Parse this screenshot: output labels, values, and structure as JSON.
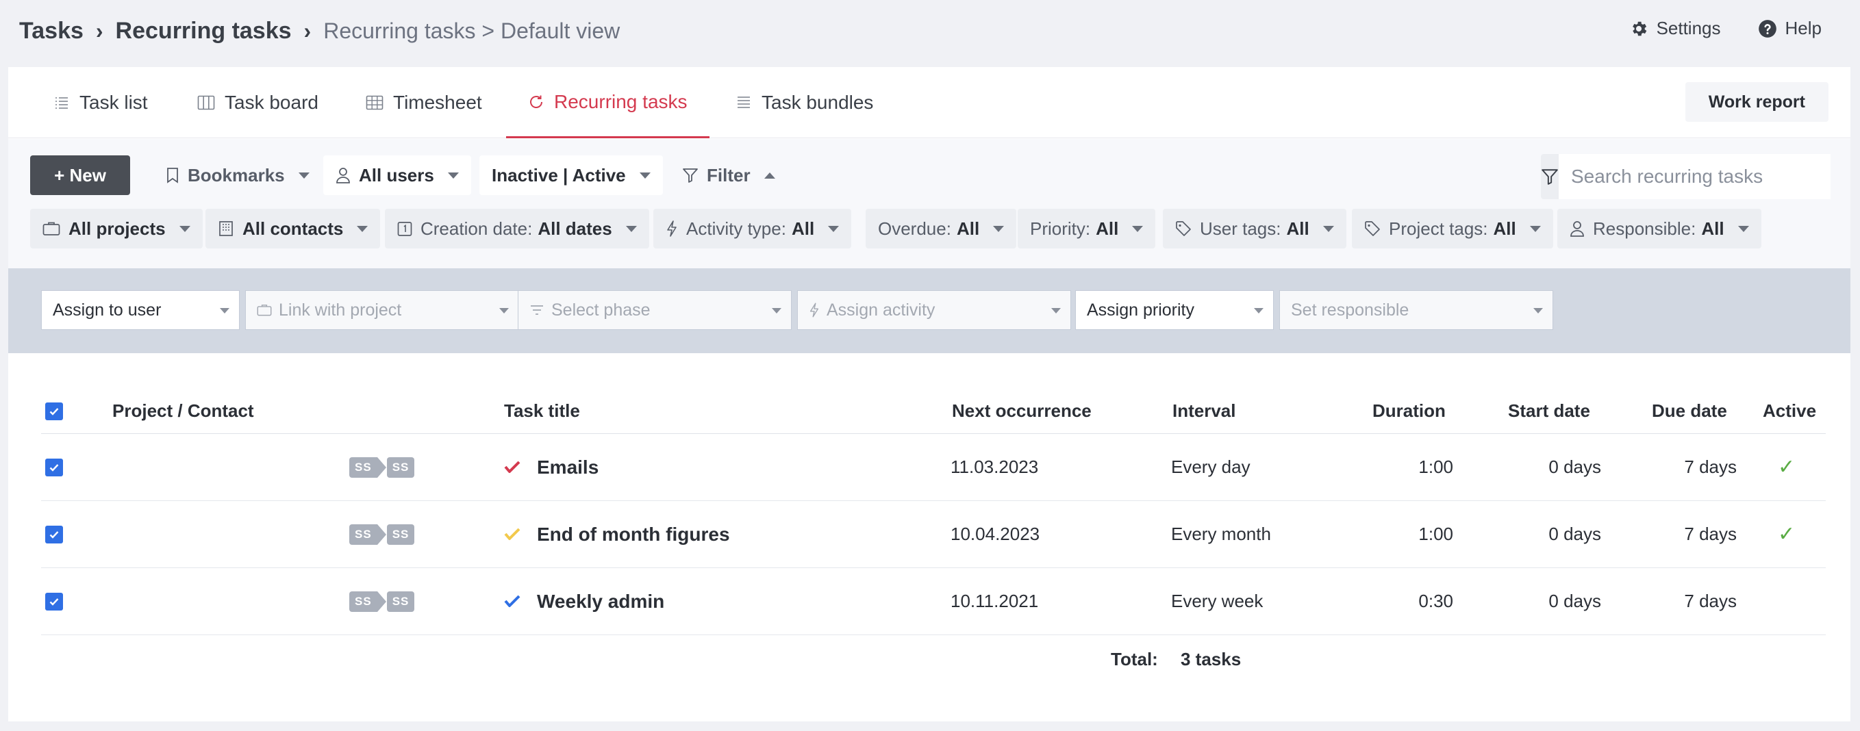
{
  "breadcrumb": {
    "root": "Tasks",
    "sep1": "›",
    "section": "Recurring tasks",
    "sep2": "›",
    "view": "Recurring tasks > Default view"
  },
  "top_actions": {
    "settings": "Settings",
    "help": "Help"
  },
  "tabs": [
    {
      "label": "Task list",
      "icon": "list-icon"
    },
    {
      "label": "Task board",
      "icon": "board-icon"
    },
    {
      "label": "Timesheet",
      "icon": "grid-icon"
    },
    {
      "label": "Recurring tasks",
      "icon": "recurring-icon",
      "active": true
    },
    {
      "label": "Task bundles",
      "icon": "bundle-icon"
    }
  ],
  "work_report": "Work report",
  "toolbar": {
    "new_label": "+ New",
    "bookmarks": "Bookmarks",
    "all_users": "All users",
    "status": "Inactive | Active",
    "filter": "Filter",
    "search_placeholder": "Search recurring tasks"
  },
  "filters": {
    "projects": {
      "value": "All projects"
    },
    "contacts": {
      "value": "All contacts"
    },
    "creation_date": {
      "label": "Creation date:",
      "value": "All dates"
    },
    "activity_type": {
      "label": "Activity type:",
      "value": "All"
    },
    "overdue": {
      "label": "Overdue:",
      "value": "All"
    },
    "priority": {
      "label": "Priority:",
      "value": "All"
    },
    "user_tags": {
      "label": "User tags:",
      "value": "All"
    },
    "project_tags": {
      "label": "Project tags:",
      "value": "All"
    },
    "responsible": {
      "label": "Responsible:",
      "value": "All"
    }
  },
  "bulk": {
    "assign_user": "Assign to user",
    "link_project": "Link with project",
    "select_phase": "Select phase",
    "assign_activity": "Assign activity",
    "assign_priority": "Assign priority",
    "set_responsible": "Set responsible"
  },
  "table": {
    "headers": {
      "project": "Project / Contact",
      "title": "Task title",
      "next": "Next occurrence",
      "interval": "Interval",
      "duration": "Duration",
      "start": "Start date",
      "due": "Due date",
      "active": "Active"
    },
    "rows": [
      {
        "badge1": "SS",
        "badge2": "SS",
        "title": "Emails",
        "priority_color": "#d43a4f",
        "next": "11.03.2023",
        "interval": "Every day",
        "duration": "1:00",
        "start": "0 days",
        "due": "7 days",
        "active": "✓"
      },
      {
        "badge1": "SS",
        "badge2": "SS",
        "title": "End of month figures",
        "priority_color": "#f2c94c",
        "next": "10.04.2023",
        "interval": "Every month",
        "duration": "1:00",
        "start": "0 days",
        "due": "7 days",
        "active": "✓"
      },
      {
        "badge1": "SS",
        "badge2": "SS",
        "title": "Weekly admin",
        "priority_color": "#2f6fe4",
        "next": "10.11.2021",
        "interval": "Every week",
        "duration": "0:30",
        "start": "0 days",
        "due": "7 days",
        "active": ""
      }
    ],
    "total_label": "Total:",
    "total_value": "3 tasks"
  },
  "colors": {
    "accent": "#d43a4f",
    "check_blue": "#2f6fe4",
    "active_green": "#5aac44"
  }
}
